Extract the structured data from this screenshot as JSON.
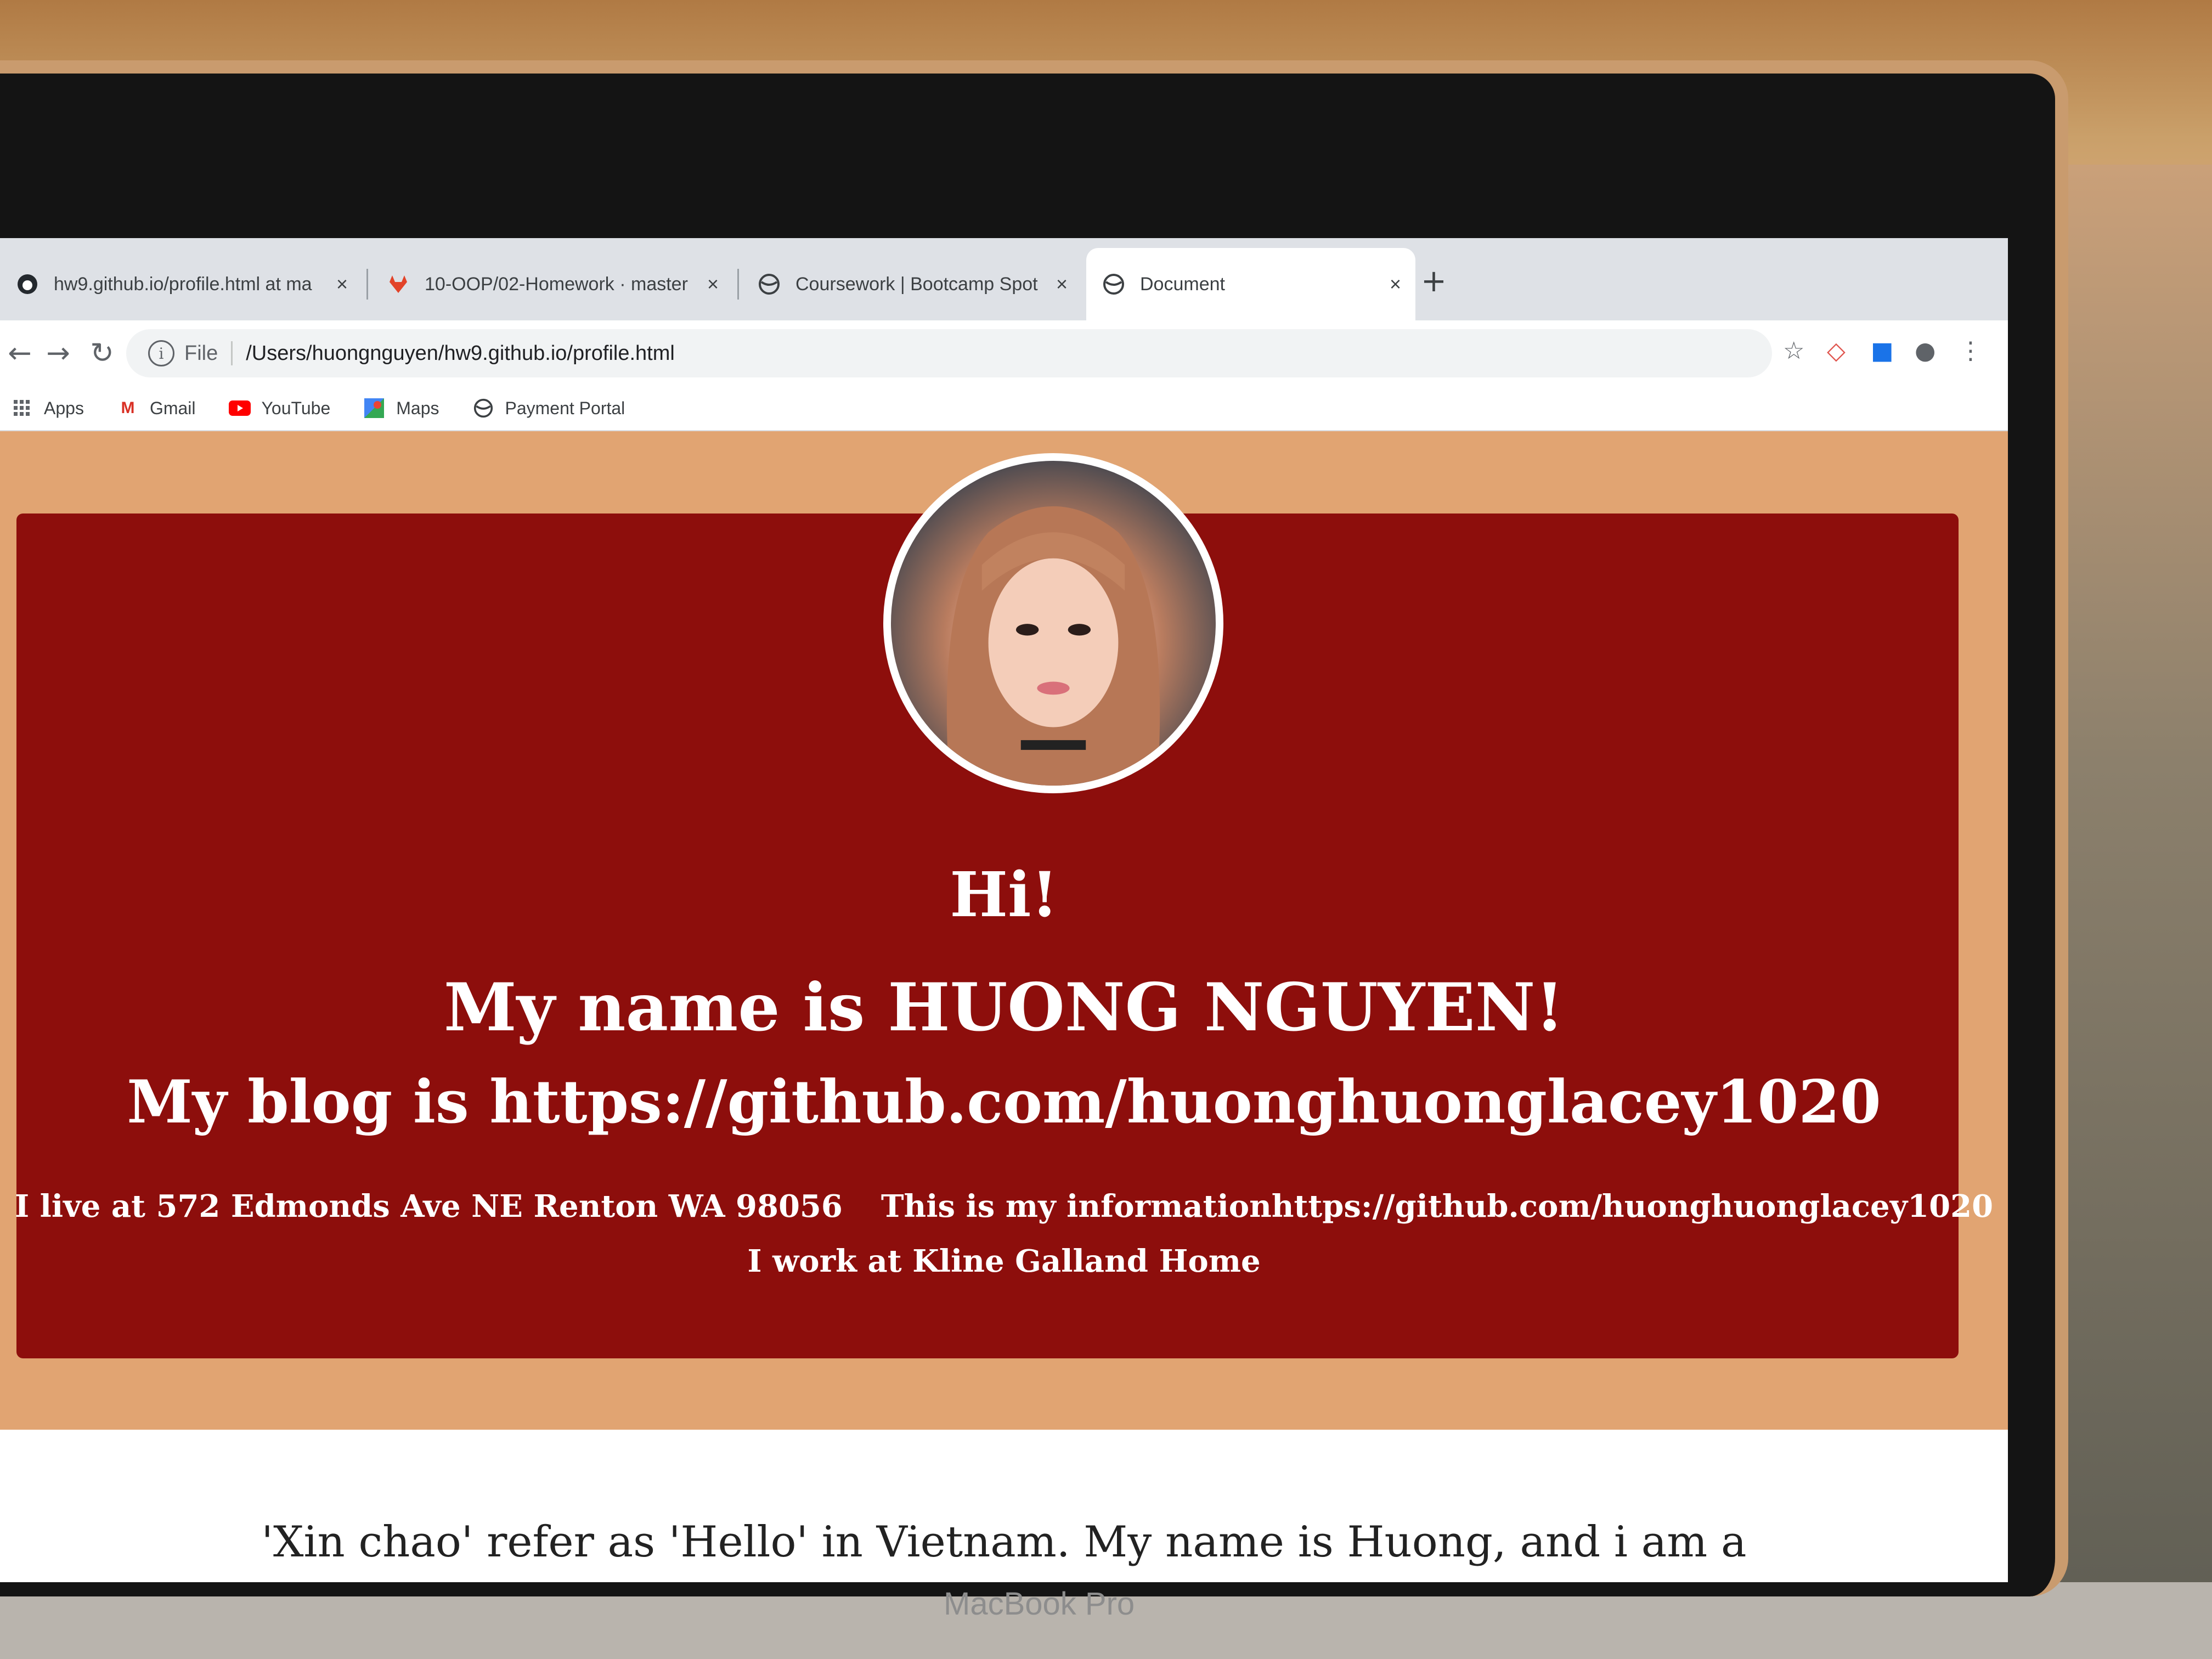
{
  "device": {
    "bezel_label": "MacBook Pro"
  },
  "browser": {
    "tabs": [
      {
        "title": "hw9.github.io/profile.html at ma",
        "icon": "github-icon",
        "active": false
      },
      {
        "title": "10-OOP/02-Homework · master",
        "icon": "gitlab-icon",
        "active": false
      },
      {
        "title": "Coursework | Bootcamp Spot",
        "icon": "globe-icon",
        "active": false
      },
      {
        "title": "Document",
        "icon": "globe-icon",
        "active": true
      }
    ],
    "new_tab": "+",
    "close_glyph": "×",
    "omnibox": {
      "scheme_label": "File",
      "url": "/Users/huongnguyen/hw9.github.io/profile.html"
    },
    "bookmarks": [
      {
        "label": "Apps",
        "icon": "apps-grid-icon"
      },
      {
        "label": "Gmail",
        "icon": "gmail-icon"
      },
      {
        "label": "YouTube",
        "icon": "youtube-icon"
      },
      {
        "label": "Maps",
        "icon": "maps-icon"
      },
      {
        "label": "Payment Portal",
        "icon": "globe-icon"
      }
    ]
  },
  "page": {
    "greeting": "Hi!",
    "name_line": "My name is HUONG NGUYEN!",
    "blog_line": "My blog is https://github.com/huonghuonglacey1020",
    "address_line": "I live at 572 Edmonds Ave NE Renton WA 98056",
    "information_line": "This is my informationhttps://github.com/huonghuonglacey1020",
    "work_line": "I work at Kline Galland Home",
    "intro_line": "'Xin chao' refer as 'Hello' in Vietnam. My name is Huong, and i am a"
  },
  "colors": {
    "hero": "#8d0e0c",
    "page_band": "#e1a472",
    "text_on_hero": "#ffffff"
  }
}
